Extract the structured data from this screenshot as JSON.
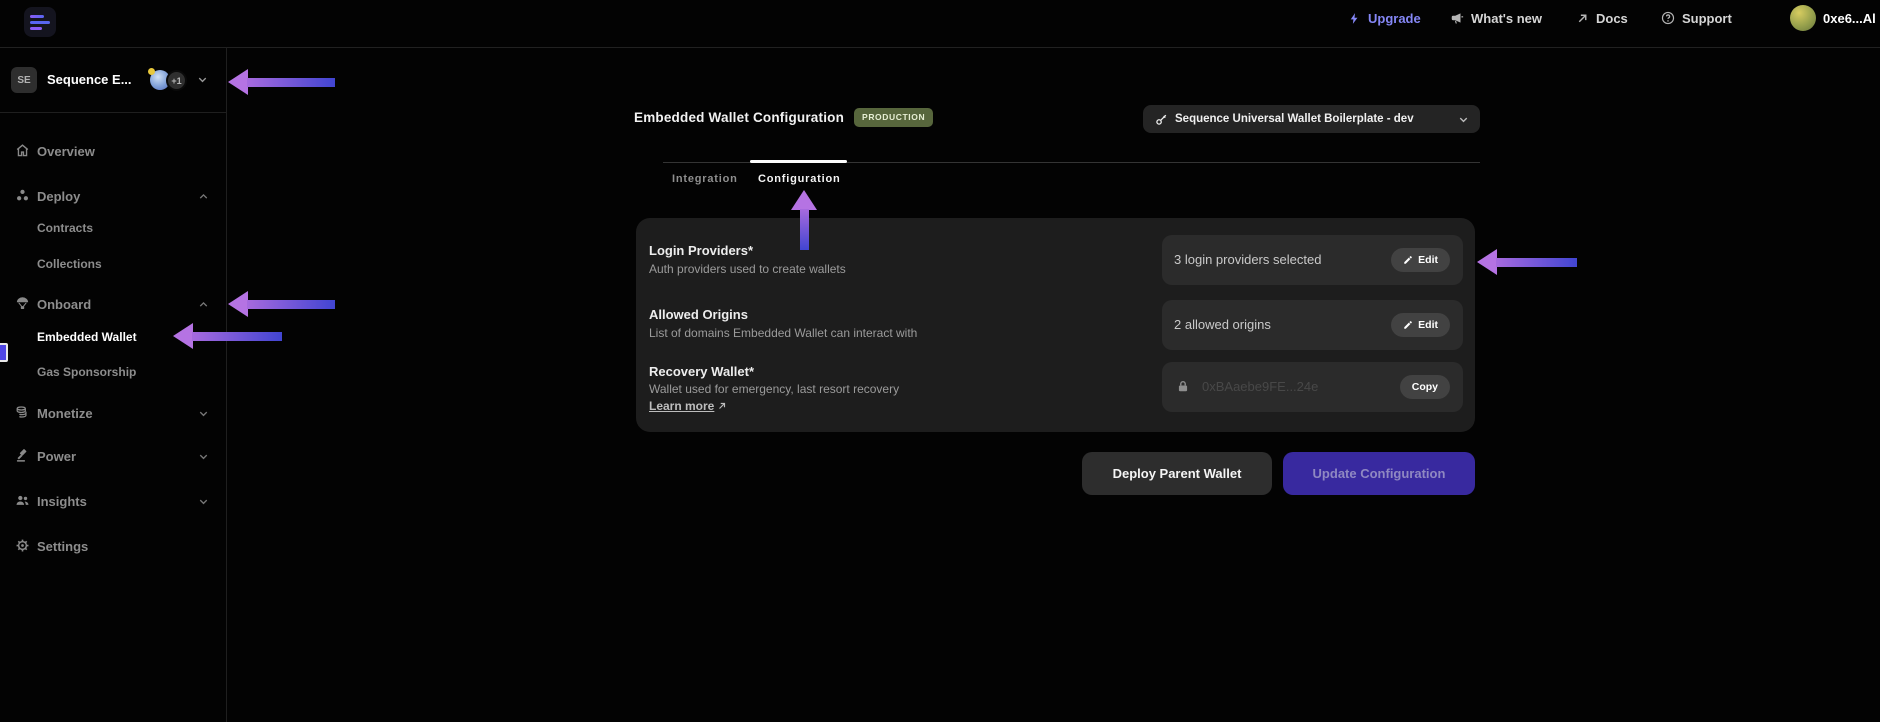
{
  "colors": {
    "accent_purple": "#8587f6",
    "arrow_head": "#b573e3",
    "arrow_tail": "#4145d2",
    "badge_bg": "#57663c",
    "update_button_bg": "#38299f"
  },
  "header": {
    "upgrade": "Upgrade",
    "whats_new": "What's new",
    "docs": "Docs",
    "support": "Support",
    "account": "0xe6...Al"
  },
  "sidebar": {
    "project_initials": "SE",
    "project_name": "Sequence E...",
    "project_count_badge": "+1",
    "overview": "Overview",
    "deploy": "Deploy",
    "contracts": "Contracts",
    "collections": "Collections",
    "onboard": "Onboard",
    "embedded_wallet": "Embedded Wallet",
    "gas_sponsorship": "Gas Sponsorship",
    "monetize": "Monetize",
    "power": "Power",
    "insights": "Insights",
    "settings": "Settings"
  },
  "main": {
    "title": "Embedded Wallet Configuration",
    "env_badge": "PRODUCTION",
    "project_selector": "Sequence Universal Wallet Boilerplate - dev",
    "tabs": {
      "integration": "Integration",
      "configuration": "Configuration",
      "active": "Configuration"
    },
    "rows": [
      {
        "title": "Login Providers*",
        "desc": "Auth providers used to create wallets",
        "value": "3 login providers selected",
        "action": "Edit"
      },
      {
        "title": "Allowed Origins",
        "desc": "List of domains Embedded Wallet can interact with",
        "value": "2 allowed origins",
        "action": "Edit"
      },
      {
        "title": "Recovery Wallet*",
        "desc": "Wallet used for emergency, last resort recovery",
        "link": "Learn more",
        "value": "0xBAaebe9FE...24e",
        "action": "Copy"
      }
    ],
    "deploy_button": "Deploy Parent Wallet",
    "update_button": "Update Configuration"
  },
  "annotations": {
    "arrows": [
      {
        "points_at": "project-switcher",
        "direction": "left"
      },
      {
        "points_at": "onboard-nav-item",
        "direction": "left"
      },
      {
        "points_at": "embedded-wallet-nav-item",
        "direction": "left"
      },
      {
        "points_at": "configuration-tab",
        "direction": "up"
      },
      {
        "points_at": "login-providers-edit-row",
        "direction": "left"
      }
    ]
  }
}
